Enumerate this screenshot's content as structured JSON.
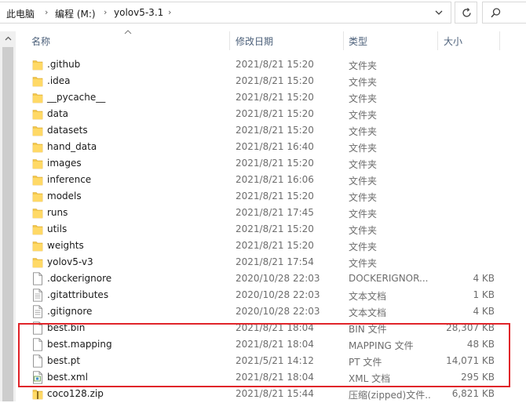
{
  "address": {
    "crumbs": [
      "此电脑",
      "编程 (M:)",
      "yolov5-3.1"
    ],
    "separator": "›"
  },
  "columns": {
    "name": "名称",
    "modified": "修改日期",
    "type": "类型",
    "size": "大小"
  },
  "files": [
    {
      "name": ".github",
      "date": "2021/8/21 15:20",
      "type": "文件夹",
      "size": "",
      "kind": "folder"
    },
    {
      "name": ".idea",
      "date": "2021/8/21 15:20",
      "type": "文件夹",
      "size": "",
      "kind": "folder"
    },
    {
      "name": "__pycache__",
      "date": "2021/8/21 15:20",
      "type": "文件夹",
      "size": "",
      "kind": "folder"
    },
    {
      "name": "data",
      "date": "2021/8/21 15:20",
      "type": "文件夹",
      "size": "",
      "kind": "folder"
    },
    {
      "name": "datasets",
      "date": "2021/8/21 15:20",
      "type": "文件夹",
      "size": "",
      "kind": "folder"
    },
    {
      "name": "hand_data",
      "date": "2021/8/21 16:40",
      "type": "文件夹",
      "size": "",
      "kind": "folder"
    },
    {
      "name": "images",
      "date": "2021/8/21 15:20",
      "type": "文件夹",
      "size": "",
      "kind": "folder"
    },
    {
      "name": "inference",
      "date": "2021/8/21 16:06",
      "type": "文件夹",
      "size": "",
      "kind": "folder"
    },
    {
      "name": "models",
      "date": "2021/8/21 15:20",
      "type": "文件夹",
      "size": "",
      "kind": "folder"
    },
    {
      "name": "runs",
      "date": "2021/8/21 17:45",
      "type": "文件夹",
      "size": "",
      "kind": "folder"
    },
    {
      "name": "utils",
      "date": "2021/8/21 15:20",
      "type": "文件夹",
      "size": "",
      "kind": "folder"
    },
    {
      "name": "weights",
      "date": "2021/8/21 15:20",
      "type": "文件夹",
      "size": "",
      "kind": "folder"
    },
    {
      "name": "yolov5-v3",
      "date": "2021/8/21 17:54",
      "type": "文件夹",
      "size": "",
      "kind": "folder"
    },
    {
      "name": ".dockerignore",
      "date": "2020/10/28 22:03",
      "type": "DOCKERIGNOR...",
      "size": "4 KB",
      "kind": "file"
    },
    {
      "name": ".gitattributes",
      "date": "2020/10/28 22:03",
      "type": "文本文档",
      "size": "1 KB",
      "kind": "text"
    },
    {
      "name": ".gitignore",
      "date": "2020/10/28 22:03",
      "type": "文本文档",
      "size": "4 KB",
      "kind": "text"
    },
    {
      "name": "best.bin",
      "date": "2021/8/21 18:04",
      "type": "BIN 文件",
      "size": "28,307 KB",
      "kind": "file"
    },
    {
      "name": "best.mapping",
      "date": "2021/8/21 18:04",
      "type": "MAPPING 文件",
      "size": "48 KB",
      "kind": "file"
    },
    {
      "name": "best.pt",
      "date": "2021/5/21 14:12",
      "type": "PT 文件",
      "size": "14,071 KB",
      "kind": "file"
    },
    {
      "name": "best.xml",
      "date": "2021/8/21 18:04",
      "type": "XML 文档",
      "size": "295 KB",
      "kind": "xml"
    },
    {
      "name": "coco128.zip",
      "date": "2021/8/21 15:44",
      "type": "压缩(zipped)文件...",
      "size": "6,821 KB",
      "kind": "zip"
    }
  ]
}
